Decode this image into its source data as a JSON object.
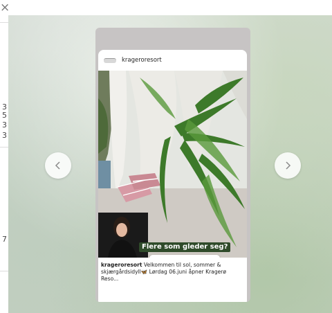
{
  "background_page": {
    "close_label": "×",
    "numbers": [
      "3",
      "5",
      "3",
      "3",
      "7"
    ]
  },
  "story": {
    "username": "krageroresort",
    "sticker": {
      "question": "Flere som gleder seg?",
      "emoji": "💯",
      "fill": 0.0
    },
    "caption": {
      "username": "krageroresort",
      "text": "Velkommen til sol, sommer & skjærgårdsidyll🦋 Lørdag 06.juni åpner Kragerø Reso..."
    }
  },
  "navigation": {
    "prev_icon": "chevron-left-icon",
    "next_icon": "chevron-right-icon"
  },
  "colors": {
    "sticker_bg": "#2f4b2a",
    "emoji_red": "#e0261b"
  }
}
